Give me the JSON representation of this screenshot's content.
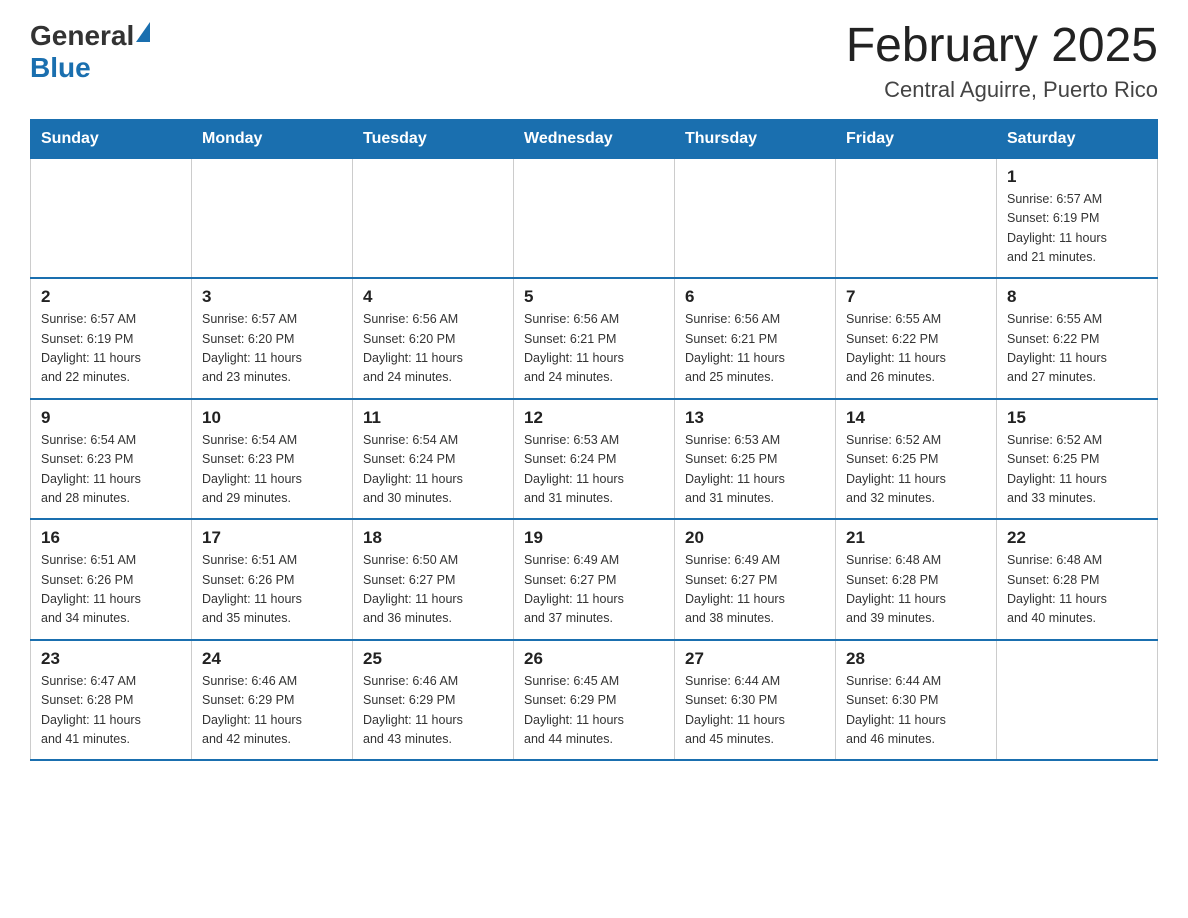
{
  "logo": {
    "general": "General",
    "blue": "Blue"
  },
  "title": "February 2025",
  "location": "Central Aguirre, Puerto Rico",
  "weekdays": [
    "Sunday",
    "Monday",
    "Tuesday",
    "Wednesday",
    "Thursday",
    "Friday",
    "Saturday"
  ],
  "weeks": [
    [
      {
        "day": "",
        "info": ""
      },
      {
        "day": "",
        "info": ""
      },
      {
        "day": "",
        "info": ""
      },
      {
        "day": "",
        "info": ""
      },
      {
        "day": "",
        "info": ""
      },
      {
        "day": "",
        "info": ""
      },
      {
        "day": "1",
        "info": "Sunrise: 6:57 AM\nSunset: 6:19 PM\nDaylight: 11 hours\nand 21 minutes."
      }
    ],
    [
      {
        "day": "2",
        "info": "Sunrise: 6:57 AM\nSunset: 6:19 PM\nDaylight: 11 hours\nand 22 minutes."
      },
      {
        "day": "3",
        "info": "Sunrise: 6:57 AM\nSunset: 6:20 PM\nDaylight: 11 hours\nand 23 minutes."
      },
      {
        "day": "4",
        "info": "Sunrise: 6:56 AM\nSunset: 6:20 PM\nDaylight: 11 hours\nand 24 minutes."
      },
      {
        "day": "5",
        "info": "Sunrise: 6:56 AM\nSunset: 6:21 PM\nDaylight: 11 hours\nand 24 minutes."
      },
      {
        "day": "6",
        "info": "Sunrise: 6:56 AM\nSunset: 6:21 PM\nDaylight: 11 hours\nand 25 minutes."
      },
      {
        "day": "7",
        "info": "Sunrise: 6:55 AM\nSunset: 6:22 PM\nDaylight: 11 hours\nand 26 minutes."
      },
      {
        "day": "8",
        "info": "Sunrise: 6:55 AM\nSunset: 6:22 PM\nDaylight: 11 hours\nand 27 minutes."
      }
    ],
    [
      {
        "day": "9",
        "info": "Sunrise: 6:54 AM\nSunset: 6:23 PM\nDaylight: 11 hours\nand 28 minutes."
      },
      {
        "day": "10",
        "info": "Sunrise: 6:54 AM\nSunset: 6:23 PM\nDaylight: 11 hours\nand 29 minutes."
      },
      {
        "day": "11",
        "info": "Sunrise: 6:54 AM\nSunset: 6:24 PM\nDaylight: 11 hours\nand 30 minutes."
      },
      {
        "day": "12",
        "info": "Sunrise: 6:53 AM\nSunset: 6:24 PM\nDaylight: 11 hours\nand 31 minutes."
      },
      {
        "day": "13",
        "info": "Sunrise: 6:53 AM\nSunset: 6:25 PM\nDaylight: 11 hours\nand 31 minutes."
      },
      {
        "day": "14",
        "info": "Sunrise: 6:52 AM\nSunset: 6:25 PM\nDaylight: 11 hours\nand 32 minutes."
      },
      {
        "day": "15",
        "info": "Sunrise: 6:52 AM\nSunset: 6:25 PM\nDaylight: 11 hours\nand 33 minutes."
      }
    ],
    [
      {
        "day": "16",
        "info": "Sunrise: 6:51 AM\nSunset: 6:26 PM\nDaylight: 11 hours\nand 34 minutes."
      },
      {
        "day": "17",
        "info": "Sunrise: 6:51 AM\nSunset: 6:26 PM\nDaylight: 11 hours\nand 35 minutes."
      },
      {
        "day": "18",
        "info": "Sunrise: 6:50 AM\nSunset: 6:27 PM\nDaylight: 11 hours\nand 36 minutes."
      },
      {
        "day": "19",
        "info": "Sunrise: 6:49 AM\nSunset: 6:27 PM\nDaylight: 11 hours\nand 37 minutes."
      },
      {
        "day": "20",
        "info": "Sunrise: 6:49 AM\nSunset: 6:27 PM\nDaylight: 11 hours\nand 38 minutes."
      },
      {
        "day": "21",
        "info": "Sunrise: 6:48 AM\nSunset: 6:28 PM\nDaylight: 11 hours\nand 39 minutes."
      },
      {
        "day": "22",
        "info": "Sunrise: 6:48 AM\nSunset: 6:28 PM\nDaylight: 11 hours\nand 40 minutes."
      }
    ],
    [
      {
        "day": "23",
        "info": "Sunrise: 6:47 AM\nSunset: 6:28 PM\nDaylight: 11 hours\nand 41 minutes."
      },
      {
        "day": "24",
        "info": "Sunrise: 6:46 AM\nSunset: 6:29 PM\nDaylight: 11 hours\nand 42 minutes."
      },
      {
        "day": "25",
        "info": "Sunrise: 6:46 AM\nSunset: 6:29 PM\nDaylight: 11 hours\nand 43 minutes."
      },
      {
        "day": "26",
        "info": "Sunrise: 6:45 AM\nSunset: 6:29 PM\nDaylight: 11 hours\nand 44 minutes."
      },
      {
        "day": "27",
        "info": "Sunrise: 6:44 AM\nSunset: 6:30 PM\nDaylight: 11 hours\nand 45 minutes."
      },
      {
        "day": "28",
        "info": "Sunrise: 6:44 AM\nSunset: 6:30 PM\nDaylight: 11 hours\nand 46 minutes."
      },
      {
        "day": "",
        "info": ""
      }
    ]
  ]
}
